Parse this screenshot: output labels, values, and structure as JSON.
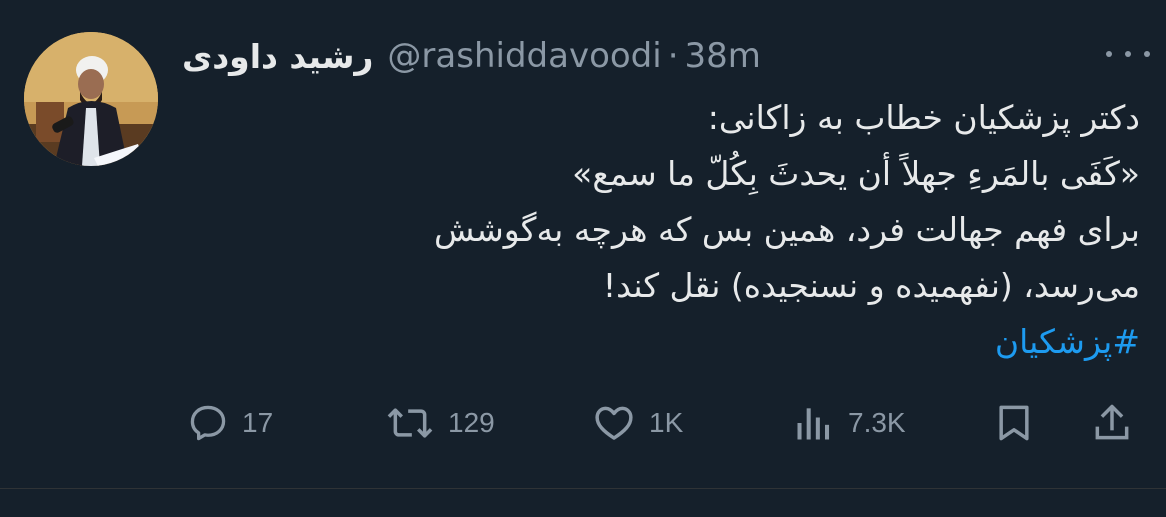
{
  "tweet": {
    "display_name": "رشید داودی",
    "handle": "@rashiddavoodi",
    "separator": "·",
    "time": "38m",
    "lines": [
      "دکتر پزشکیان خطاب به زاکانی:",
      "«كَفَى بالمَرءِ جهلاً أن يحدثَ بِكُلّ ما سمع»",
      "برای فهم جهالت فرد، همین بس که هرچه به‌گوشش",
      "می‌رسد، (نفهمیده و نسنجیده) نقل کند!"
    ],
    "hashtag": "#پزشکیان"
  },
  "actions": {
    "replies": "17",
    "retweets": "129",
    "likes": "1K",
    "views": "7.3K"
  },
  "colors": {
    "background": "#15202b",
    "text": "#e7e9ea",
    "muted": "#8b98a5",
    "link": "#1d9bf0"
  },
  "icons": [
    "avatar",
    "more-icon",
    "reply-icon",
    "retweet-icon",
    "like-icon",
    "views-icon",
    "bookmark-icon",
    "share-icon"
  ]
}
